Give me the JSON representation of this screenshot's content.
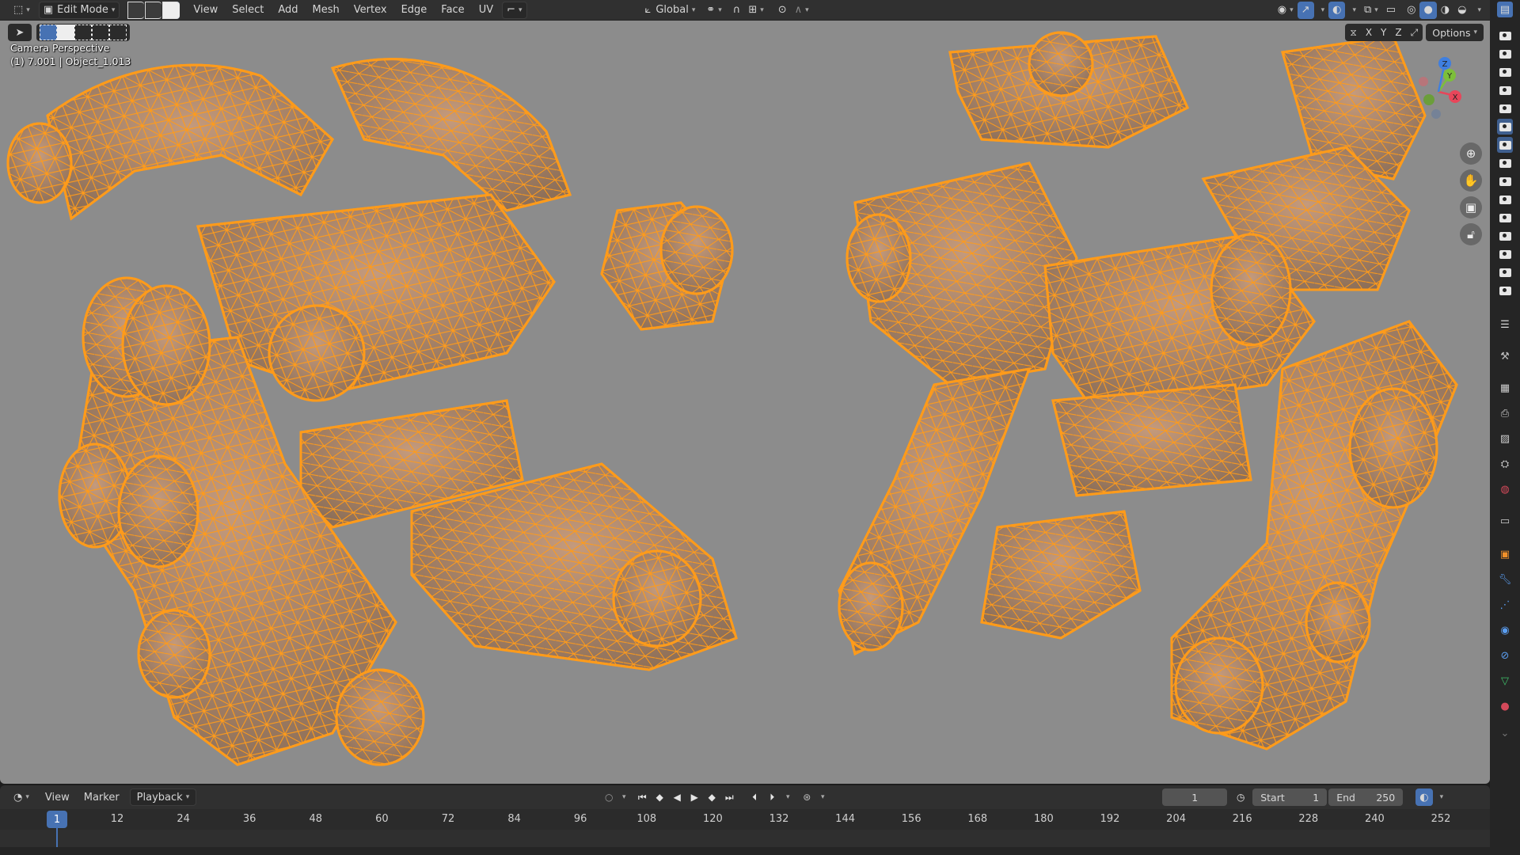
{
  "header": {
    "mode_label": "Edit Mode",
    "menus": [
      "View",
      "Select",
      "Add",
      "Mesh",
      "Vertex",
      "Edge",
      "Face",
      "UV"
    ],
    "transform_orientation": "Global"
  },
  "viewport": {
    "perspective_label": "Camera Perspective",
    "object_info": "(1) 7.001 | Object_1.013",
    "axes": [
      "X",
      "Y",
      "Z"
    ],
    "options_label": "Options",
    "gizmo_axes": [
      "X",
      "Y",
      "Z"
    ],
    "accent_color": "#ff9b1a",
    "background_color": "#8c8c8c"
  },
  "timeline": {
    "menus": [
      "View",
      "Marker",
      "Playback"
    ],
    "current_frame": "1",
    "start_label": "Start",
    "start_value": "1",
    "end_label": "End",
    "end_value": "250",
    "ruler_ticks": [
      "12",
      "24",
      "36",
      "48",
      "60",
      "72",
      "84",
      "96",
      "108",
      "120",
      "132",
      "144",
      "156",
      "168",
      "180",
      "192",
      "204",
      "216",
      "228",
      "240",
      "252"
    ],
    "playhead_label": "1"
  },
  "icons": {
    "editor_type": "cube-editor-icon",
    "transform": "axis-transform-icon",
    "pivot": "pivot-icon",
    "snap": "magnet-icon",
    "proportional": "proportional-edit-icon",
    "visibility": "eye-icon",
    "gizmo": "gizmo-icon",
    "overlay": "overlay-icon",
    "xray": "xray-icon",
    "shading_wire": "wireframe-shading-icon",
    "shading_solid": "solid-shading-icon",
    "shading_material": "material-shading-icon",
    "shading_render": "rendered-shading-icon",
    "zoom": "zoom-icon",
    "pan": "hand-icon",
    "camera": "camera-icon",
    "lock": "lock-icon",
    "keyframe": "keyframe-icon",
    "stopwatch": "stopwatch-icon",
    "autokey": "record-icon"
  }
}
